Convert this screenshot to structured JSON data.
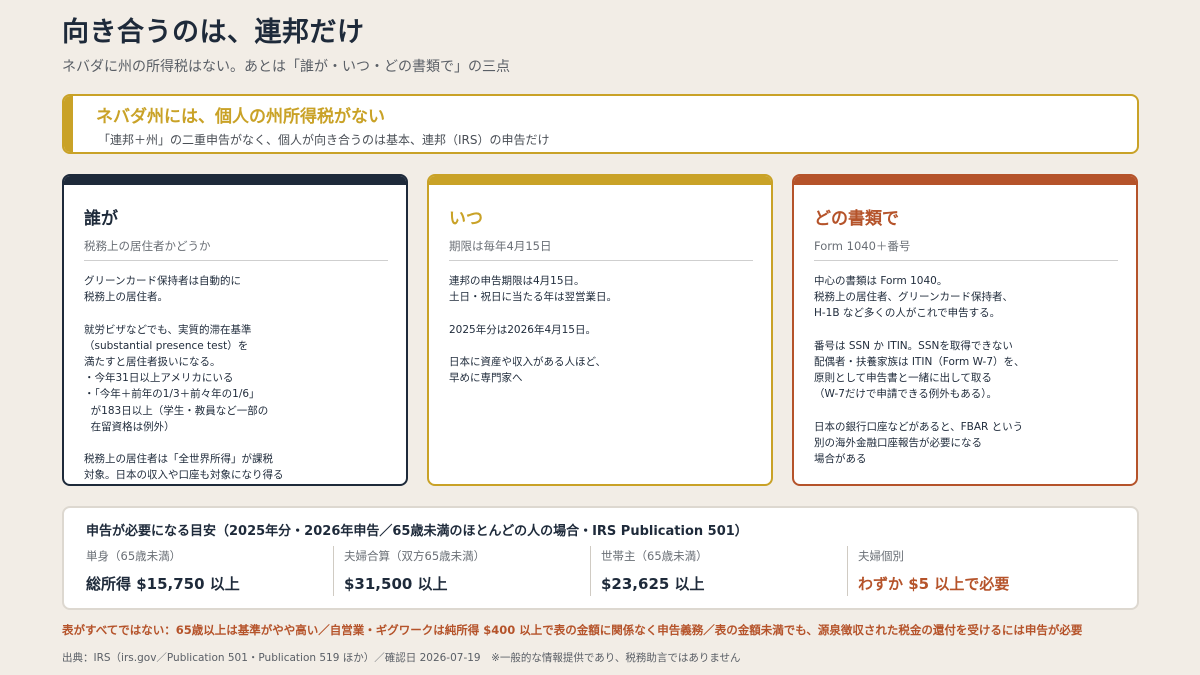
{
  "header": {
    "title": "向き合うのは、連邦だけ",
    "subtitle": "ネバダに州の所得税はない。あとは「誰が・いつ・どの書類で」の三点"
  },
  "banner": {
    "title": "ネバダ州には、個人の州所得税がない",
    "text": "「連邦＋州」の二重申告がなく、個人が向き合うのは基本、連邦（IRS）の申告だけ"
  },
  "cards": [
    {
      "heading": "誰が",
      "subheading": "税務上の居住者かどうか",
      "lines": [
        "グリーンカード保持者は自動的に",
        "税務上の居住者。",
        "",
        "就労ビザなどでも、実質的滞在基準",
        "（substantial presence test）を",
        "満たすと居住者扱いになる。",
        "・今年31日以上アメリカにいる",
        "・「今年＋前年の1/3＋前々年の1/6」",
        "  が183日以上（学生・教員など一部の",
        "  在留資格は例外）",
        "",
        "税務上の居住者は「全世界所得」が課税",
        "対象。日本の収入や口座も対象になり得る"
      ],
      "accent": "#1e2a3a"
    },
    {
      "heading": "いつ",
      "subheading": "期限は毎年4月15日",
      "lines": [
        "連邦の申告期限は4月15日。",
        "土日・祝日に当たる年は翌営業日。",
        "",
        "2025年分は2026年4月15日。",
        "",
        "日本に資産や収入がある人ほど、",
        "早めに専門家へ"
      ],
      "accent": "#c9a227"
    },
    {
      "heading": "どの書類で",
      "subheading": "Form 1040＋番号",
      "lines": [
        "中心の書類は Form 1040。",
        "税務上の居住者、グリーンカード保持者、",
        "H-1B など多くの人がこれで申告する。",
        "",
        "番号は SSN か ITIN。SSNを取得できない",
        "配偶者・扶養家族は ITIN（Form W-7）を、",
        "原則として申告書と一緒に出して取る",
        "（W-7だけで申請できる例外もある）。",
        "",
        "日本の銀行口座などがあると、FBAR という",
        "別の海外金融口座報告が必要になる",
        "場合がある"
      ],
      "accent": "#b5532a"
    }
  ],
  "thresholds": {
    "title": "申告が必要になる目安（2025年分・2026年申告／65歳未満のほとんどの人の場合・IRS Publication 501）",
    "columns": [
      {
        "label": "単身（65歳未満）",
        "value": "総所得 $15,750 以上"
      },
      {
        "label": "夫婦合算（双方65歳未満）",
        "value": "$31,500 以上"
      },
      {
        "label": "世帯主（65歳未満）",
        "value": "$23,625 以上"
      },
      {
        "label": "夫婦個別",
        "value": "わずか $5 以上で必要"
      }
    ]
  },
  "warning": "表がすべてではない：65歳以上は基準がやや高い／自営業・ギグワークは純所得 $400 以上で表の金額に関係なく申告義務／表の金額未満でも、源泉徴収された税金の還付を受けるには申告が必要",
  "source": "出典：IRS（irs.gov／Publication 501・Publication 519 ほか）／確認日 2026-07-19　※一般的な情報提供であり、税務助言ではありません",
  "colors": {
    "navy": "#1e2a3a",
    "gold": "#c9a227",
    "rust": "#b5532a",
    "background": "#f2ede6"
  }
}
